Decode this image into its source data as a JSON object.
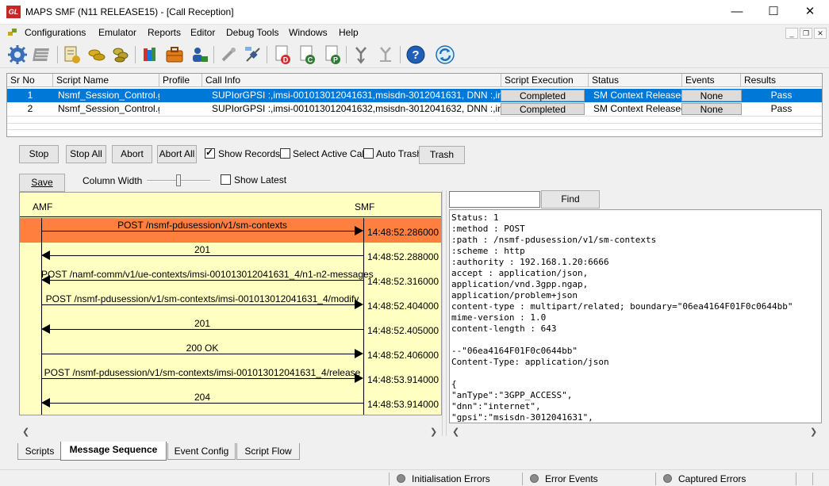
{
  "window": {
    "logo_text": "GL",
    "title": "MAPS SMF (N11 RELEASE15) - [Call Reception]",
    "controls": {
      "minimize": "—",
      "maximize": "☐",
      "close": "✕"
    }
  },
  "menu": {
    "items": [
      "Configurations",
      "Emulator",
      "Reports",
      "Editor",
      "Debug Tools",
      "Windows",
      "Help"
    ],
    "mdi": {
      "minimize": "_",
      "restore": "❐",
      "close": "✕"
    }
  },
  "toolbar": {
    "buttons": [
      "gear-icon",
      "list-icon",
      "script-edit-icon",
      "gold-coins-icon",
      "coins-icon",
      "color-books-icon",
      "briefcase-icon",
      "user-lock-icon",
      "pen-disabled-icon",
      "satellite-icon",
      "document-d-icon",
      "document-c-icon",
      "document-p-icon",
      "merge-arrows-icon",
      "merge-disabled-icon",
      "help-icon",
      "refresh-icon"
    ],
    "doc_letters": {
      "d": "D",
      "c": "C",
      "p": "P"
    },
    "help_glyph": "?"
  },
  "call_grid": {
    "columns": [
      "Sr No",
      "Script Name",
      "Profile",
      "Call Info",
      "Script Execution",
      "Status",
      "Events",
      "Results"
    ],
    "rows": [
      {
        "sr_no": "1",
        "script_name": "Nsmf_Session_Control.gls",
        "profile": "",
        "call_info": "SUPIorGPSI :,imsi-001013012041631,msisdn-3012041631, DNN :,internet",
        "script_execution": "Completed",
        "status": "SM Context Released",
        "events": "None",
        "results": "Pass",
        "selected": true
      },
      {
        "sr_no": "2",
        "script_name": "Nsmf_Session_Control.gls",
        "profile": "",
        "call_info": "SUPIorGPSI :,imsi-001013012041632,msisdn-3012041632, DNN :,internet",
        "script_execution": "Completed",
        "status": "SM Context Released",
        "events": "None",
        "results": "Pass",
        "selected": false
      }
    ]
  },
  "controls": {
    "stop": "Stop",
    "stop_all": "Stop All",
    "abort": "Abort",
    "abort_all": "Abort All",
    "show_records": {
      "label": "Show Records",
      "checked": true
    },
    "select_active_call": {
      "label": "Select Active Call",
      "checked": false
    },
    "auto_trash": {
      "label": "Auto Trash",
      "checked": false
    },
    "trash": "Trash"
  },
  "sequence_panel": {
    "save": "Save",
    "column_width_label": "Column Width",
    "show_latest": {
      "label": "Show Latest",
      "checked": false
    }
  },
  "ladder": {
    "endpoints": {
      "left": "AMF",
      "right": "SMF"
    },
    "highlight_color": "#ff7f3f",
    "background_color": "#ffffc2",
    "messages": [
      {
        "label": "POST /nsmf-pdusession/v1/sm-contexts",
        "time": "14:48:52.286000",
        "direction": "right",
        "highlighted": true
      },
      {
        "label": "201",
        "time": "14:48:52.288000",
        "direction": "left",
        "highlighted": false
      },
      {
        "label": "POST /namf-comm/v1/ue-contexts/imsi-001013012041631_4/n1-n2-messages",
        "time": "14:48:52.316000",
        "direction": "left",
        "highlighted": false
      },
      {
        "label": "POST /nsmf-pdusession/v1/sm-contexts/imsi-001013012041631_4/modify",
        "time": "14:48:52.404000",
        "direction": "right",
        "highlighted": false
      },
      {
        "label": "201",
        "time": "14:48:52.405000",
        "direction": "left",
        "highlighted": false
      },
      {
        "label": "200 OK",
        "time": "14:48:52.406000",
        "direction": "right",
        "highlighted": false
      },
      {
        "label": "POST /nsmf-pdusession/v1/sm-contexts/imsi-001013012041631_4/release",
        "time": "14:48:53.914000",
        "direction": "right",
        "highlighted": false
      },
      {
        "label": "204",
        "time": "14:48:53.914000",
        "direction": "left",
        "highlighted": false
      }
    ]
  },
  "details": {
    "search_value": "",
    "find": "Find",
    "lines": [
      "Status: 1",
      ":method : POST",
      ":path : /nsmf-pdusession/v1/sm-contexts",
      ":scheme : http",
      ":authority : 192.168.1.20:6666",
      "accept : application/json,",
      "application/vnd.3gpp.ngap,",
      "application/problem+json",
      "content-type : multipart/related; boundary=\"06ea4164F01F0c0644bb\"",
      "mime-version : 1.0",
      "content-length : 643",
      "",
      "--\"06ea4164F01F0c0644bb\"",
      "Content-Type: application/json",
      "",
      "{",
      "\"anType\":\"3GPP_ACCESS\",",
      "\"dnn\":\"internet\",",
      "\"gpsi\":\"msisdn-3012041631\","
    ]
  },
  "tabs": {
    "items": [
      "Scripts",
      "Message Sequence",
      "Event Config",
      "Script Flow"
    ],
    "active": "Message Sequence"
  },
  "status_bar": {
    "initialisation_errors": "Initialisation Errors",
    "error_events": "Error Events",
    "captured_errors": "Captured Errors"
  },
  "colors": {
    "selection": "#0078d7",
    "highlight": "#ff7f3f",
    "ladder_bg": "#ffffc2"
  }
}
